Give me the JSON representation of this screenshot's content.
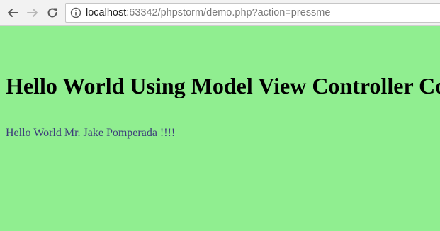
{
  "browser": {
    "url_host": "localhost",
    "url_rest": ":63342/phpstorm/demo.php?action=pressme",
    "icons": {
      "back": "back-arrow-icon",
      "forward": "forward-arrow-icon",
      "reload": "reload-icon",
      "info": "info-icon"
    }
  },
  "page": {
    "background_color": "#90ee90",
    "heading": "Hello World Using Model View Controller Co",
    "link_text": "Hello World Mr. Jake Pomperada !!!!"
  }
}
